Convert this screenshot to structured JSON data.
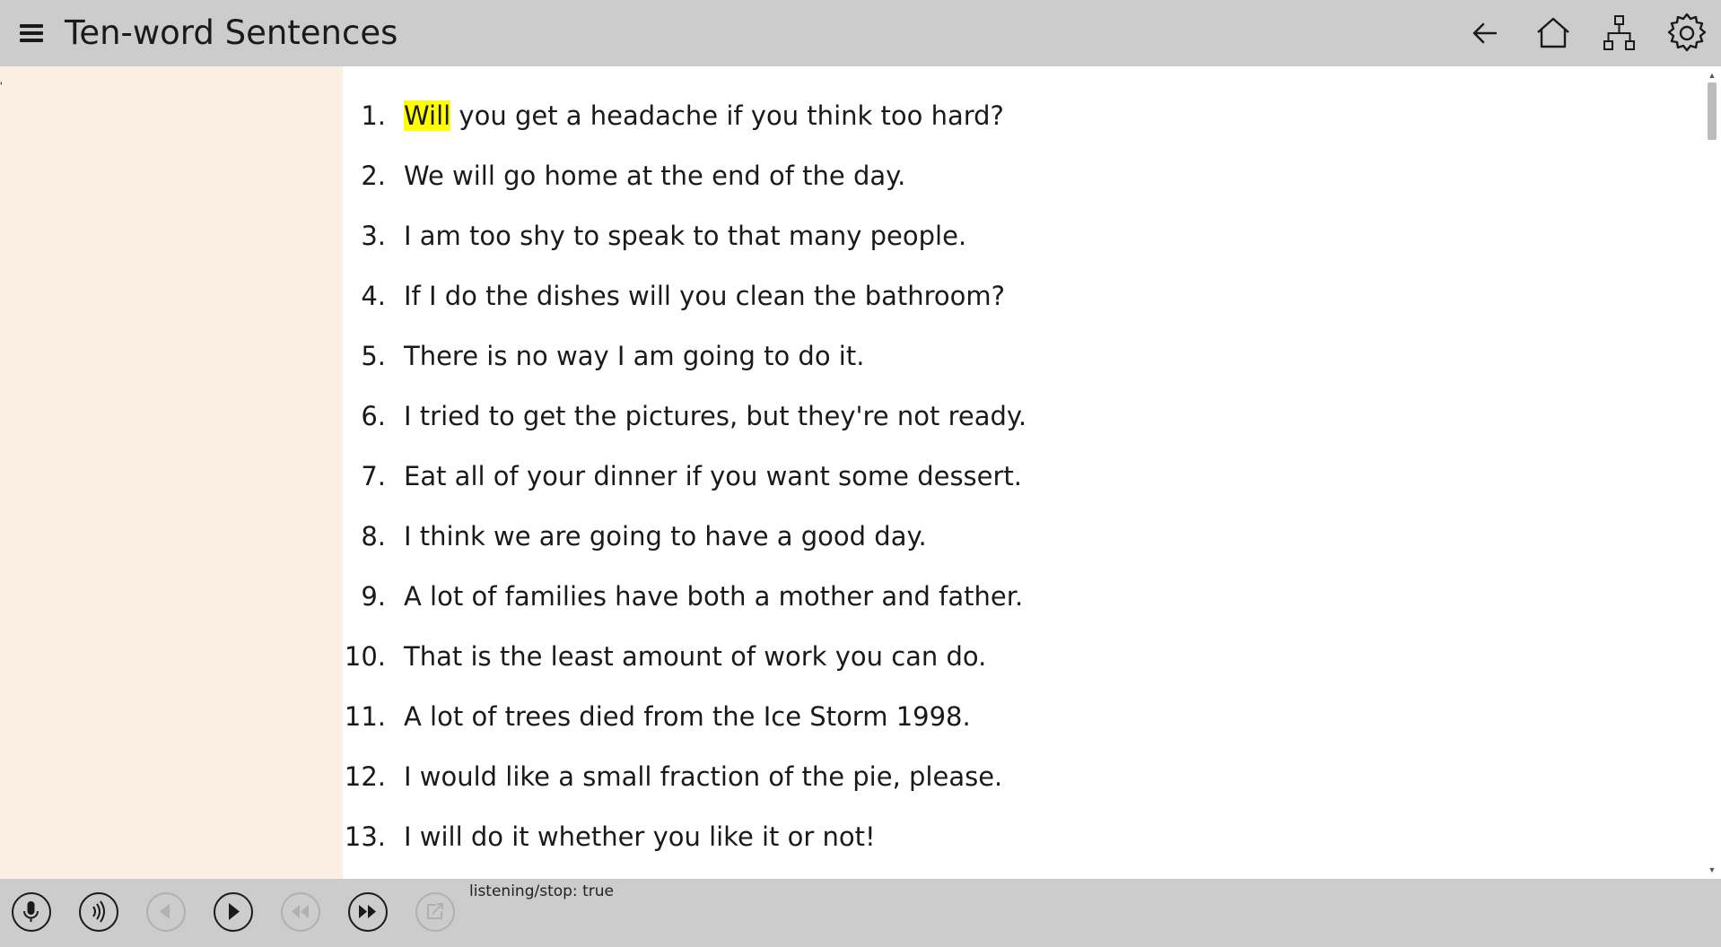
{
  "header": {
    "title": "Ten-word Sentences",
    "menu_icon": "hamburger-menu-icon",
    "back_icon": "back-arrow-icon",
    "home_icon": "home-icon",
    "sitemap_icon": "sitemap-icon",
    "settings_icon": "gear-icon"
  },
  "sidebar": {
    "mark": "'"
  },
  "sentences": [
    {
      "num": "1.",
      "highlight": "Will",
      "text": " you get a headache if you think too hard?"
    },
    {
      "num": "2.",
      "highlight": "",
      "text": "We will go home at the end of the day."
    },
    {
      "num": "3.",
      "highlight": "",
      "text": "I am too shy to speak to that many people."
    },
    {
      "num": "4.",
      "highlight": "",
      "text": "If I do the dishes will you clean the bathroom?"
    },
    {
      "num": "5.",
      "highlight": "",
      "text": "There is no way I am going to do it."
    },
    {
      "num": "6.",
      "highlight": "",
      "text": "I tried to get the pictures, but they're not ready."
    },
    {
      "num": "7.",
      "highlight": "",
      "text": "Eat all of your dinner if you want some dessert."
    },
    {
      "num": "8.",
      "highlight": "",
      "text": "I think we are going to have a good day."
    },
    {
      "num": "9.",
      "highlight": "",
      "text": "A lot of families have both a mother and father."
    },
    {
      "num": "10.",
      "highlight": "",
      "text": "That is the least amount of work you can do."
    },
    {
      "num": "11.",
      "highlight": "",
      "text": "A lot of trees died from the Ice Storm 1998."
    },
    {
      "num": "12.",
      "highlight": "",
      "text": "I would like a small fraction of the pie, please."
    },
    {
      "num": "13.",
      "highlight": "",
      "text": "I will do it whether you like it or not!"
    }
  ],
  "footer": {
    "status_text": "listening/stop: true",
    "controls": [
      "microphone-icon",
      "speaker-icon",
      "previous-icon",
      "play-icon",
      "rewind-icon",
      "fast-forward-icon",
      "share-icon"
    ]
  },
  "colors": {
    "titlebar": "#cccccc",
    "sidebar": "#fbefe4",
    "highlight": "#ffff00"
  }
}
